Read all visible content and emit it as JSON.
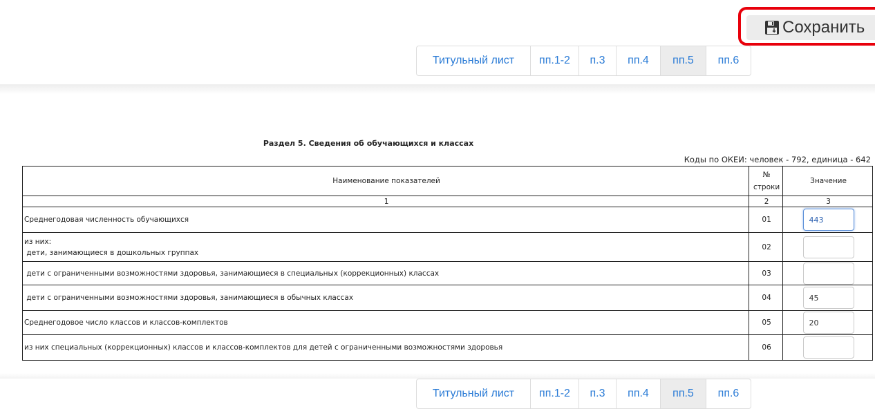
{
  "toolbar": {
    "save_label": "Сохранить"
  },
  "tabs": [
    {
      "label": "Титульный лист",
      "active": false
    },
    {
      "label": "пп.1-2",
      "active": false
    },
    {
      "label": "п.3",
      "active": false
    },
    {
      "label": "пп.4",
      "active": false
    },
    {
      "label": "пп.5",
      "active": true
    },
    {
      "label": "пп.6",
      "active": false
    }
  ],
  "section": {
    "title": "Раздел 5. Сведения об обучающихся и классах",
    "okei_note": "Коды по ОКЕИ: человек - 792, единица - 642"
  },
  "table": {
    "header": {
      "name": "Наименование показателей",
      "code_line1": "№",
      "code_line2": "строки",
      "value": "Значение"
    },
    "col_numbers": [
      "1",
      "2",
      "3"
    ],
    "rows": [
      {
        "name": "Среднегодовая численность обучающихся",
        "code": "01",
        "value": "443"
      },
      {
        "name_line1": "из них:",
        "name": " дети, занимающиеся в дошкольных группах",
        "code": "02",
        "value": ""
      },
      {
        "name": " дети с ограниченными возможностями здоровья, занимающиеся в специальных (коррекционных) классах",
        "code": "03",
        "value": ""
      },
      {
        "name": " дети с ограниченными возможностями здоровья, занимающиеся в обычных классах",
        "code": "04",
        "value": "45"
      },
      {
        "name": "Среднегодовое число классов и классов-комплектов",
        "code": "05",
        "value": "20"
      },
      {
        "name": "из них специальных (коррекционных) классов и классов-комплектов для детей с ограниченными возможностями здоровья",
        "code": "06",
        "value": ""
      }
    ]
  },
  "colors": {
    "accent": "#2a7bd6",
    "highlight": "#e8000b"
  }
}
